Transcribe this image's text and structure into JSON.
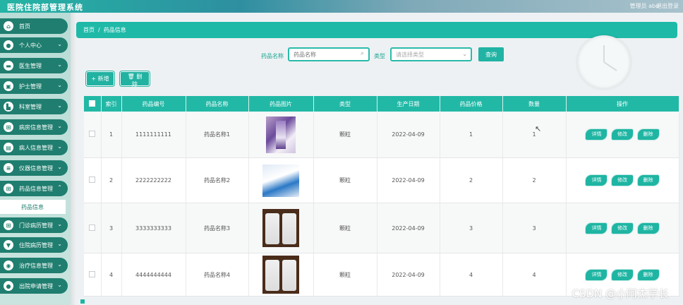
{
  "app": {
    "title": "医院住院部管理系统",
    "user_info": "管理员 abo",
    "logout": "退出登录"
  },
  "sidebar": {
    "items": [
      {
        "label": "首页",
        "icon": "home-icon",
        "has_children": false
      },
      {
        "label": "个人中心",
        "icon": "user-icon",
        "has_children": true
      },
      {
        "label": "医生管理",
        "icon": "doctor-icon",
        "has_children": true
      },
      {
        "label": "护士管理",
        "icon": "nurse-icon",
        "has_children": true
      },
      {
        "label": "科室管理",
        "icon": "building-icon",
        "has_children": true
      },
      {
        "label": "病房信息管理",
        "icon": "grid-icon",
        "has_children": true
      },
      {
        "label": "病人信息管理",
        "icon": "patient-icon",
        "has_children": true
      },
      {
        "label": "仪器信息管理",
        "icon": "equipment-icon",
        "has_children": true
      },
      {
        "label": "药品信息管理",
        "icon": "grid-icon",
        "has_children": true
      },
      {
        "label": "门诊病历管理",
        "icon": "grid-icon",
        "has_children": true
      },
      {
        "label": "住院病历管理",
        "icon": "clipboard-icon",
        "has_children": true
      },
      {
        "label": "治疗信息管理",
        "icon": "treatment-icon",
        "has_children": true
      },
      {
        "label": "出院申请管理",
        "icon": "user-icon",
        "has_children": true
      }
    ],
    "active_sub_item": "药品信息"
  },
  "breadcrumb": {
    "home": "首页",
    "separator": "/",
    "current": "药品信息"
  },
  "search": {
    "name_label": "药品名称",
    "name_placeholder": "药品名称",
    "type_label": "类型",
    "type_placeholder": "请选择类型",
    "query_button": "查询"
  },
  "actions": {
    "add_label": "+ 新增",
    "delete_label": "🗑 删除"
  },
  "table": {
    "headers": [
      "",
      "索引",
      "药品编号",
      "药品名称",
      "药品图片",
      "类型",
      "生产日期",
      "药品价格",
      "数量",
      "操作"
    ],
    "rows": [
      {
        "index": "1",
        "code": "1111111111",
        "name": "药品名称1",
        "image": "medicine-box",
        "type": "颗粒",
        "date": "2022-04-09",
        "price": "1",
        "qty": "1"
      },
      {
        "index": "2",
        "code": "2222222222",
        "name": "药品名称2",
        "image": "medicine-pack",
        "type": "颗粒",
        "date": "2022-04-09",
        "price": "2",
        "qty": "2"
      },
      {
        "index": "3",
        "code": "3333333333",
        "name": "药品名称3",
        "image": "medicine-bottles",
        "type": "颗粒",
        "date": "2022-04-09",
        "price": "3",
        "qty": "3"
      },
      {
        "index": "4",
        "code": "4444444444",
        "name": "药品名称4",
        "image": "medicine-bottles",
        "type": "颗粒",
        "date": "2022-04-09",
        "price": "4",
        "qty": "4"
      }
    ],
    "row_actions": {
      "detail": "详情",
      "edit": "修改",
      "delete": "删除"
    }
  },
  "watermark": "CSDN @小阿杰学长",
  "colors": {
    "accent": "#22b8a6",
    "sidebar_dark": "#1f7e6f"
  }
}
